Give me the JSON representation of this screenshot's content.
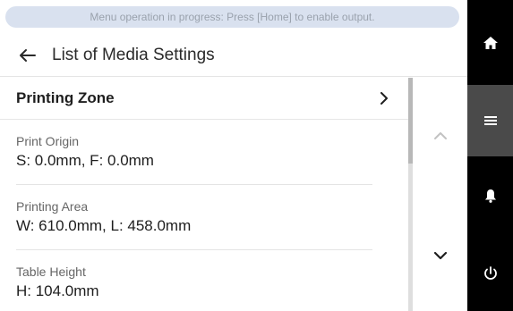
{
  "banner": {
    "text": "Menu operation in progress: Press [Home] to enable output."
  },
  "header": {
    "title": "List of Media Settings",
    "back_icon": "arrow-left-icon"
  },
  "zone": {
    "title": "Printing Zone",
    "icon": "chevron-right-icon"
  },
  "items": [
    {
      "label": "Print Origin",
      "value": "S: 0.0mm, F: 0.0mm"
    },
    {
      "label": "Printing Area",
      "value": "W: 610.0mm, L: 458.0mm"
    },
    {
      "label": "Table Height",
      "value": "H: 104.0mm"
    }
  ],
  "scroll": {
    "up_icon": "chevron-up-icon",
    "down_icon": "chevron-down-icon"
  },
  "nav": {
    "items": [
      {
        "name": "home",
        "icon": "home-icon",
        "selected": false
      },
      {
        "name": "menu",
        "icon": "menu-icon",
        "selected": true
      },
      {
        "name": "notifications",
        "icon": "bell-icon",
        "selected": false
      },
      {
        "name": "power",
        "icon": "power-icon",
        "selected": false
      }
    ]
  },
  "colors": {
    "banner_bg": "#d9e1ef",
    "banner_text": "#9aa2ad",
    "nav_bg": "#000000",
    "nav_selected": "#4a4a4a"
  }
}
